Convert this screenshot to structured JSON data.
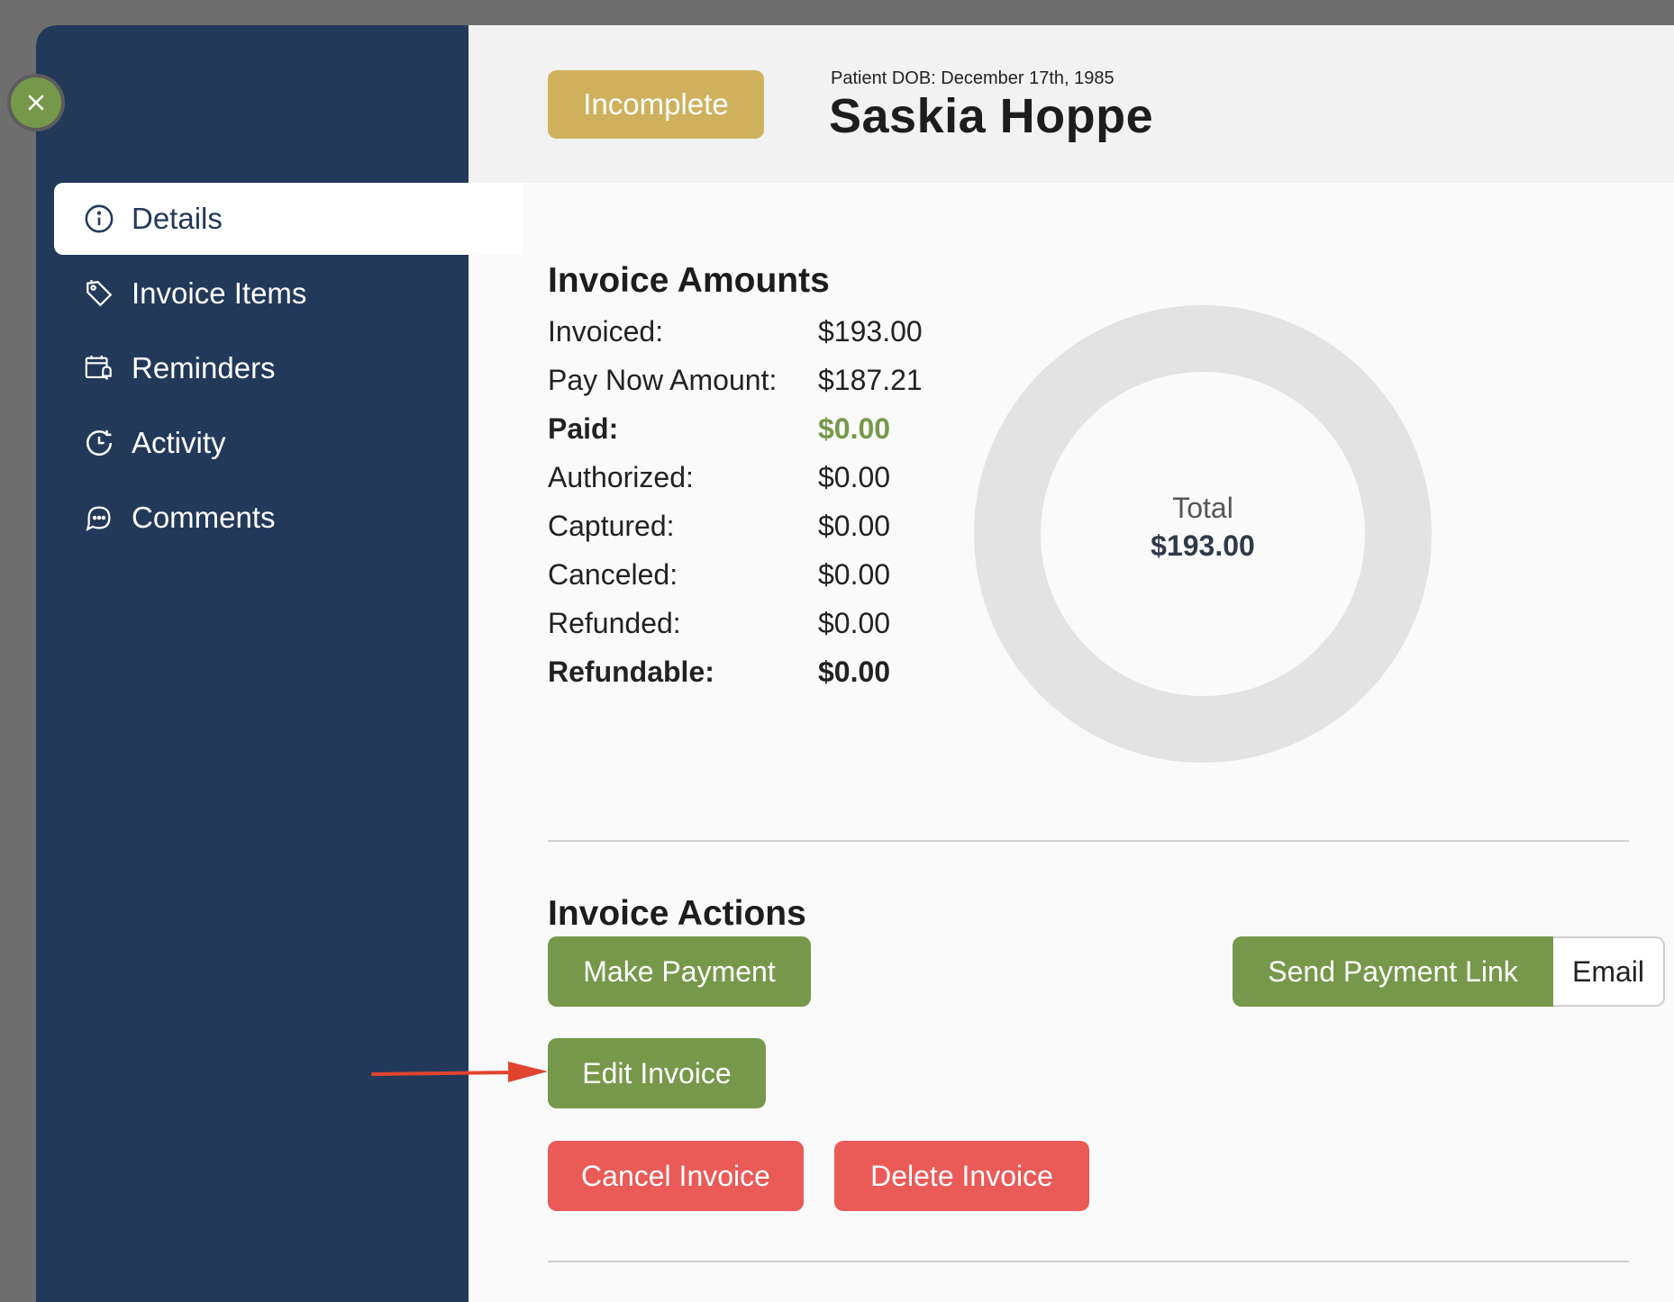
{
  "sidebar": {
    "items": [
      {
        "label": "Details",
        "icon": "info-icon",
        "active": true
      },
      {
        "label": "Invoice Items",
        "icon": "tag-icon"
      },
      {
        "label": "Reminders",
        "icon": "calendar-bell-icon"
      },
      {
        "label": "Activity",
        "icon": "clock-icon"
      },
      {
        "label": "Comments",
        "icon": "chat-icon"
      }
    ]
  },
  "header": {
    "status": "Incomplete",
    "dob": "Patient DOB: December 17th, 1985",
    "patient_name": "Saskia Hoppe"
  },
  "amounts": {
    "title": "Invoice Amounts",
    "rows": [
      {
        "label": "Invoiced:",
        "value": "$193.00"
      },
      {
        "label": "Pay Now Amount:",
        "value": "$187.21"
      },
      {
        "label": "Paid:",
        "value": "$0.00"
      },
      {
        "label": "Authorized:",
        "value": "$0.00"
      },
      {
        "label": "Captured:",
        "value": "$0.00"
      },
      {
        "label": "Canceled:",
        "value": "$0.00"
      },
      {
        "label": "Refunded:",
        "value": "$0.00"
      },
      {
        "label": "Refundable:",
        "value": "$0.00"
      }
    ],
    "donut": {
      "label": "Total",
      "value": "$193.00",
      "ring_color": "#e3e3e3"
    }
  },
  "actions": {
    "title": "Invoice Actions",
    "make_payment": "Make Payment",
    "send_payment_link": "Send Payment Link",
    "email": "Email",
    "edit_invoice": "Edit Invoice",
    "cancel_invoice": "Cancel Invoice",
    "delete_invoice": "Delete Invoice"
  },
  "colors": {
    "sidebar": "#22395a",
    "green": "#76984a",
    "gold": "#cfb15d",
    "red": "#ea5a57",
    "annotation_arrow": "#e0442f"
  }
}
